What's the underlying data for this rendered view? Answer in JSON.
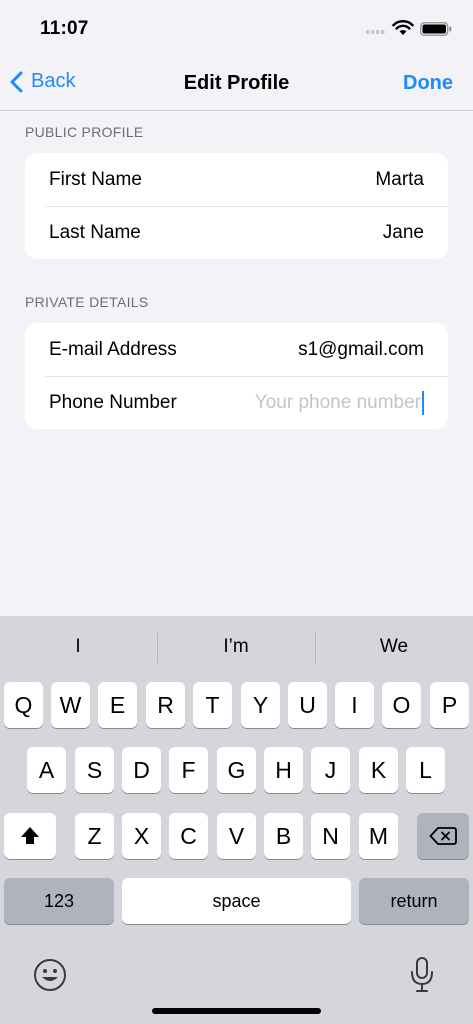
{
  "status": {
    "time": "11:07"
  },
  "nav": {
    "back_label": "Back",
    "title": "Edit Profile",
    "done_label": "Done"
  },
  "public_profile": {
    "header": "PUBLIC PROFILE",
    "rows": [
      {
        "label": "First Name",
        "value": "Marta"
      },
      {
        "label": "Last Name",
        "value": "Jane"
      }
    ]
  },
  "private_details": {
    "header": "PRIVATE DETAILS",
    "rows": [
      {
        "label": "E-mail Address",
        "value": "s1@gmail.com"
      },
      {
        "label": "Phone Number",
        "value": "",
        "placeholder": "Your phone number"
      }
    ]
  },
  "keyboard": {
    "suggestions": [
      "I",
      "I’m",
      "We"
    ],
    "row1": [
      "Q",
      "W",
      "E",
      "R",
      "T",
      "Y",
      "U",
      "I",
      "O",
      "P"
    ],
    "row2": [
      "A",
      "S",
      "D",
      "F",
      "G",
      "H",
      "J",
      "K",
      "L"
    ],
    "row3": [
      "Z",
      "X",
      "C",
      "V",
      "B",
      "N",
      "M"
    ],
    "numbers_label": "123",
    "space_label": "space",
    "return_label": "return"
  },
  "colors": {
    "accent": "#1a8cff",
    "background": "#f2f2f7",
    "keyboard_bg": "#d4d6dc"
  }
}
